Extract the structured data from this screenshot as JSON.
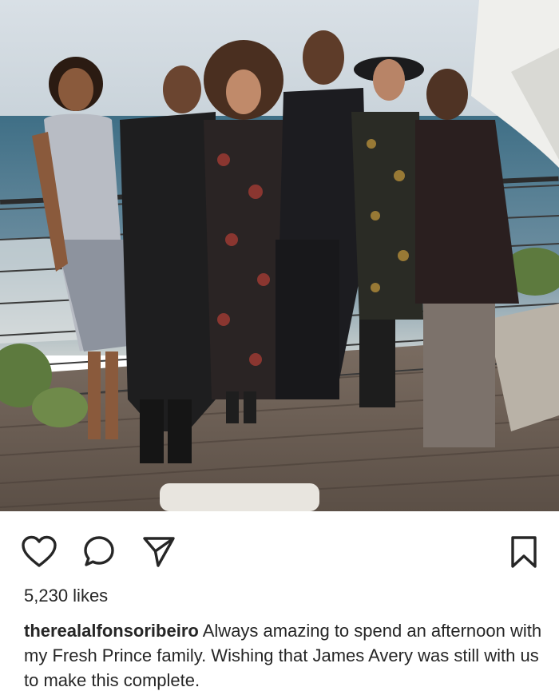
{
  "post": {
    "photo_alt_icon": "group-photo",
    "likes_text": "5,230 likes",
    "username": "therealalfonsoribeiro",
    "caption": "Always amazing to spend an afternoon with my Fresh Prince family. Wishing that James Avery was still with us to make this complete."
  },
  "actions": {
    "like_icon": "heart-icon",
    "comment_icon": "comment-icon",
    "share_icon": "send-icon",
    "save_icon": "bookmark-icon"
  },
  "colors": {
    "text": "#262626",
    "icon": "#262626",
    "background": "#ffffff"
  }
}
